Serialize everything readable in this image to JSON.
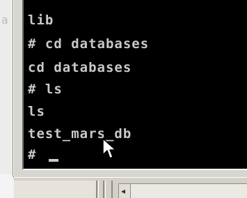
{
  "console": {
    "lines": [
      "lib",
      "# cd databases",
      "cd databases",
      "# ls",
      "ls",
      "test_mars_db"
    ],
    "prompt": "#",
    "text_color": "#c9c9c9",
    "background_color": "#000000"
  },
  "background_window": {
    "partial_glyph": "a"
  },
  "scrollbar": {
    "left_arrow_glyph": "◂"
  },
  "icons": {
    "cursor": "text-cursor-block",
    "pointer": "mouse-pointer-arrow-icon",
    "scroll_left": "arrow-left-icon"
  }
}
